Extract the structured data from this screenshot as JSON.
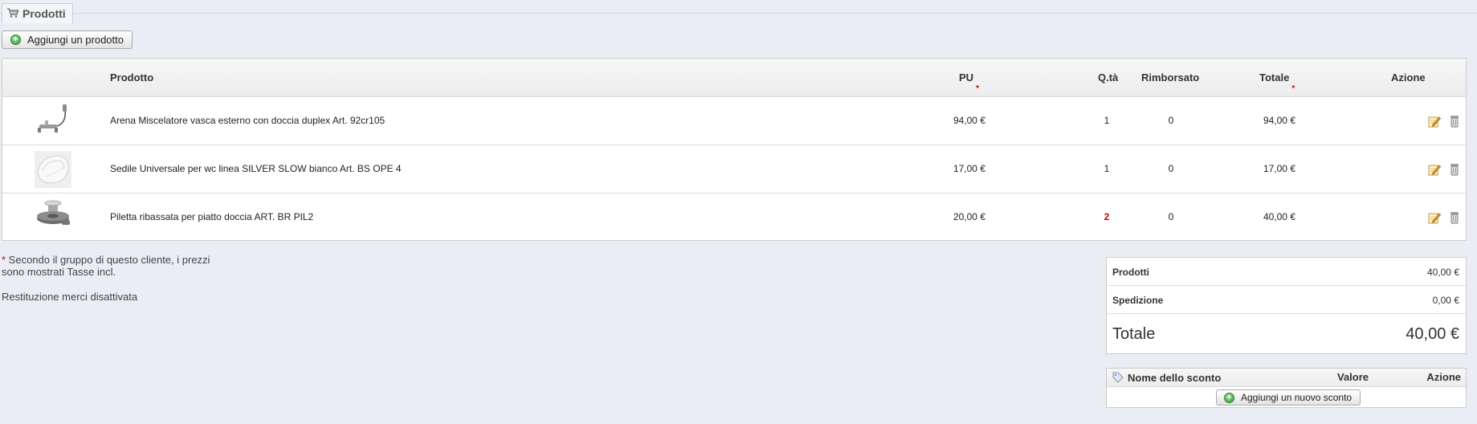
{
  "section": {
    "title": "Prodotti",
    "icon": "cart-icon"
  },
  "add_product_button": "Aggiungi un prodotto",
  "table": {
    "headers": {
      "product": "Prodotto",
      "unit_price": "PU",
      "quantity": "Q.tà",
      "refunded": "Rimborsato",
      "total": "Totale",
      "action": "Azione"
    },
    "required_marker": "*",
    "rows": [
      {
        "name": "Arena Miscelatore vasca esterno con doccia duplex Art. 92cr105",
        "unit_price": "94,00 €",
        "quantity": "1",
        "refunded": "0",
        "total": "94,00 €",
        "thumb_icon": "bath-mixer-image"
      },
      {
        "name": "Sedile Universale per wc linea SILVER SLOW bianco Art. BS OPE 4",
        "unit_price": "17,00 €",
        "quantity": "1",
        "refunded": "0",
        "total": "17,00 €",
        "thumb_icon": "toilet-seat-image"
      },
      {
        "name": "Piletta ribassata per piatto doccia ART. BR PIL2",
        "unit_price": "20,00 €",
        "quantity": "2",
        "refunded": "0",
        "total": "40,00 €",
        "thumb_icon": "shower-drain-image"
      }
    ]
  },
  "notes": {
    "tax_note_line1": " Secondo il gruppo di questo cliente, i prezzi",
    "tax_note_line2": "sono mostrati Tasse incl.",
    "returns_note": "Restituzione merci disattivata"
  },
  "totals": {
    "products_label": "Prodotti",
    "products_value": "40,00 €",
    "shipping_label": "Spedizione",
    "shipping_value": "0,00 €",
    "total_label": "Totale",
    "total_value": "40,00 €"
  },
  "discounts": {
    "name_header": "Nome dello sconto",
    "value_header": "Valore",
    "action_header": "Azione",
    "add_button": "Aggiungi un nuovo sconto"
  },
  "colors": {
    "page_bg": "#eaedf3",
    "required": "#cc0000",
    "quantity_highlight": "#cc0000"
  }
}
